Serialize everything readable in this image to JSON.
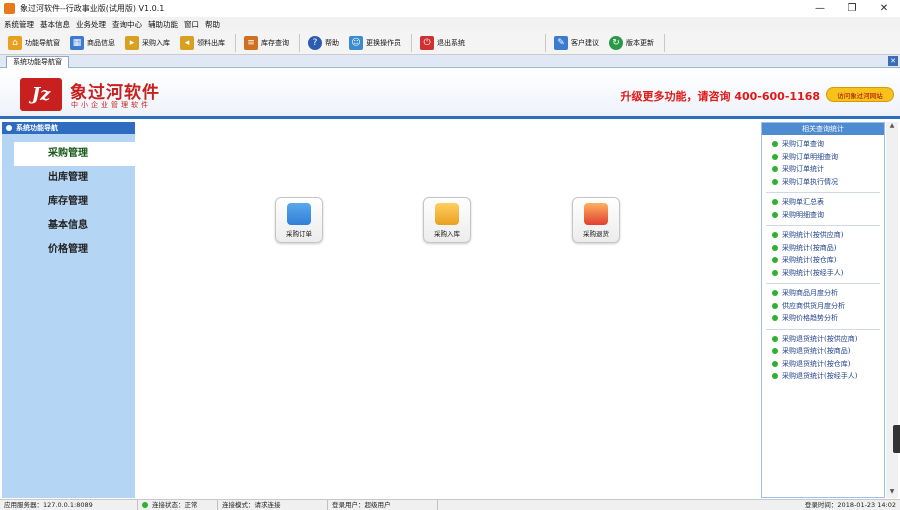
{
  "window": {
    "title": "象过河软件--行政事业版(试用版) V1.0.1",
    "controls": [
      "—",
      "❐",
      "✕"
    ]
  },
  "menu": [
    "系统管理",
    "基本信息",
    "业务处理",
    "查询中心",
    "辅助功能",
    "窗口",
    "帮助"
  ],
  "toolbar": [
    {
      "label": "功能导航窗",
      "icon": "home-icon",
      "color": "#e8a020"
    },
    {
      "label": "商品信息",
      "icon": "grid-icon",
      "color": "#3b7bd0"
    },
    {
      "label": "采购入库",
      "icon": "folder-in-icon",
      "color": "#d8a020"
    },
    {
      "label": "领料出库",
      "icon": "folder-out-icon",
      "color": "#d8a020"
    },
    {
      "label": "库存查询",
      "icon": "list-icon",
      "color": "#d07020"
    },
    {
      "label": "帮助",
      "icon": "help-icon",
      "color": "#2c5cb0"
    },
    {
      "label": "更换操作员",
      "icon": "users-icon",
      "color": "#3b8bd0"
    },
    {
      "label": "退出系统",
      "icon": "exit-icon",
      "color": "#d03030"
    },
    {
      "label": "客户建议",
      "icon": "note-icon",
      "color": "#3b7bd0"
    },
    {
      "label": "版本更新",
      "icon": "update-icon",
      "color": "#2a9a4a"
    }
  ],
  "tabstrip": {
    "active_tab": "系统功能导航窗",
    "close": "✕"
  },
  "banner": {
    "logo_mark": "Jz",
    "logo_title": "象过河软件",
    "logo_sub": "中小企业管理软件",
    "promo": "升级更多功能，请咨询 400-600-1168",
    "visit_btn": "访问象过河网站"
  },
  "leftnav": {
    "header": "系统功能导航",
    "items": [
      "采购管理",
      "出库管理",
      "库存管理",
      "基本信息",
      "价格管理"
    ],
    "active_index": 0
  },
  "main": {
    "features": [
      {
        "label": "采购订单",
        "icon": "order-icon",
        "color": "#2f7fd8"
      },
      {
        "label": "采购入库",
        "icon": "stock-in-icon",
        "color": "#e8a020"
      },
      {
        "label": "采购退货",
        "icon": "return-icon",
        "color": "#e04030"
      }
    ]
  },
  "rightpanel": {
    "header": "相关查询统计",
    "groups": [
      [
        "采购订单查询",
        "采购订单明细查询",
        "采购订单统计",
        "采购订单执行情况"
      ],
      [
        "采购单汇总表",
        "采购明细查询"
      ],
      [
        "采购统计(按供应商)",
        "采购统计(按商品)",
        "采购统计(按仓库)",
        "采购统计(按经手人)"
      ],
      [
        "采购商品月度分析",
        "供应商供货月度分析",
        "采购价格趋势分析"
      ],
      [
        "采购退货统计(按供应商)",
        "采购退货统计(按商品)",
        "采购退货统计(按仓库)",
        "采购退货统计(按经手人)"
      ]
    ]
  },
  "scroll": {
    "up": "▲",
    "down": "▼"
  },
  "statusbar": {
    "server": "应用服务器：127.0.0.1:8089",
    "conn_status": "连接状态：正常",
    "conn_mode": "连接模式：请求连接",
    "user": "登录用户：超级用户",
    "time": "登录时间：2018-01-23 14:02"
  }
}
